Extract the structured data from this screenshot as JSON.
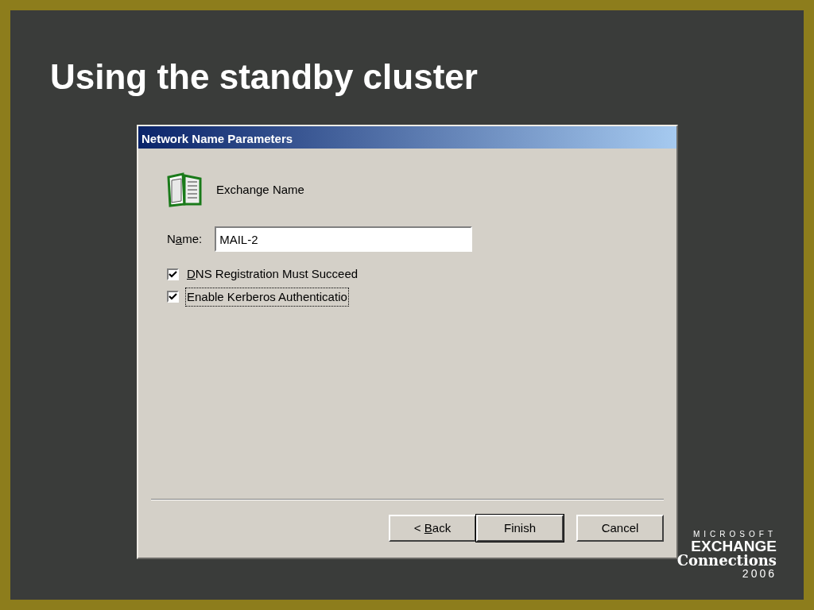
{
  "slide": {
    "title": "Using the standby cluster"
  },
  "dialog": {
    "title": "Network Name Parameters",
    "heading": "Exchange Name",
    "name_field": {
      "label_parts": [
        {
          "text": "N",
          "underlined": false
        },
        {
          "text": "a",
          "underlined": true
        },
        {
          "text": "me:",
          "underlined": false
        }
      ],
      "value": "MAIL-2"
    },
    "checkboxes": [
      {
        "label_parts": [
          {
            "text": "D",
            "underlined": true
          },
          {
            "text": "NS Registration Must Succeed",
            "underlined": false
          }
        ],
        "checked": true,
        "focused": false
      },
      {
        "label_parts": [
          {
            "text": "Enable Kerberos Authenticatio",
            "underlined": false
          }
        ],
        "checked": true,
        "focused": true
      }
    ],
    "buttons": [
      {
        "label_parts": [
          {
            "text": "< ",
            "underlined": false
          },
          {
            "text": "B",
            "underlined": true
          },
          {
            "text": "ack",
            "underlined": false
          }
        ],
        "default": false
      },
      {
        "label_parts": [
          {
            "text": "Finish",
            "underlined": false
          }
        ],
        "default": true
      },
      {
        "label_parts": [
          {
            "text": "Cancel",
            "underlined": false
          }
        ],
        "default": false
      }
    ]
  },
  "logo": {
    "lines": [
      "MICROSOFT",
      "EXCHANGE",
      "Connections",
      "2006"
    ]
  }
}
